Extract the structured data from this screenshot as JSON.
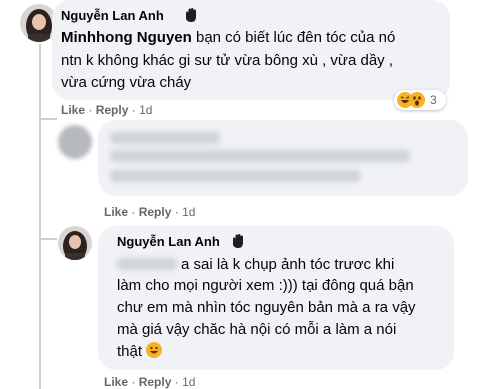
{
  "comment1": {
    "author": "Nguyễn Lan Anh",
    "mention": "Minhhong Nguyen",
    "line1_rest": " bạn có biết lúc đên tóc của nó",
    "line2": "ntn k không khác gi sư tử vừa bông xù , vừa dầy ,",
    "line3": "vừa cứng vừa cháy",
    "like": "Like",
    "reply": "Reply",
    "sep": "·",
    "time": "1d",
    "reaction_count": "3"
  },
  "comment2": {
    "like": "Like",
    "reply": "Reply",
    "sep": "·",
    "time": "1d"
  },
  "comment3": {
    "author": "Nguyễn Lan Anh",
    "line1_rest": "a sai là k chụp ảnh tóc trươc khi",
    "line2": "làm cho mọi người xem :))) tại đông quá bận",
    "line3": "chư em mà nhìn tóc nguyên bản mà a ra vậy",
    "line4": "mà giá vậy chăc hà nội có mỗi a làm a nói",
    "line5": "thật",
    "like": "Like",
    "reply": "Reply",
    "sep": "·",
    "time": "1d"
  },
  "icons": {
    "badge": "hand-badge-icon",
    "emoji": "grin-emoji-icon"
  }
}
